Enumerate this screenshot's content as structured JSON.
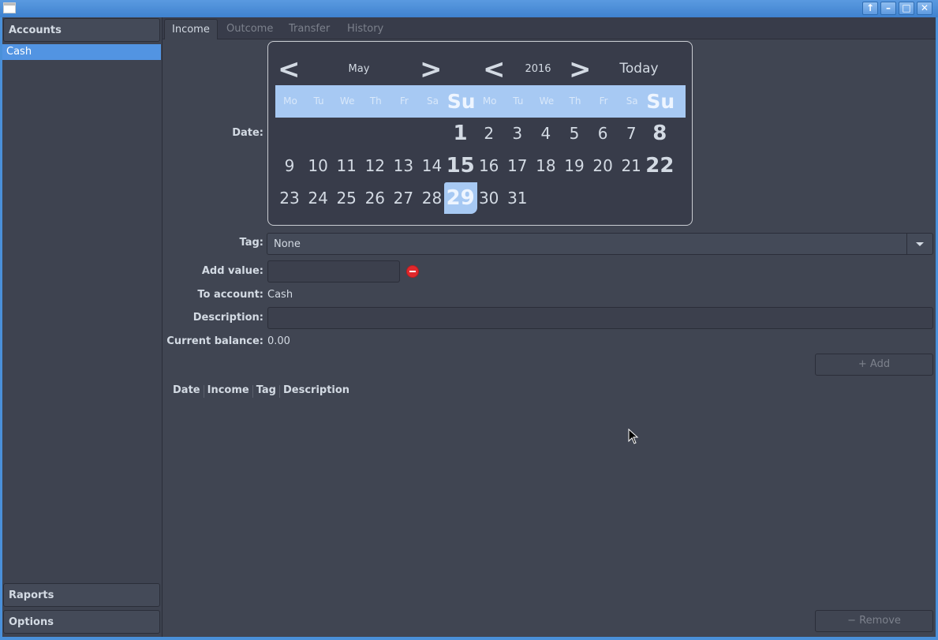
{
  "window": {
    "title_buttons": [
      "up-arrow",
      "minimize",
      "maximize",
      "close"
    ]
  },
  "sidebar": {
    "accounts_header": "Accounts",
    "accounts": [
      {
        "label": "Cash",
        "selected": true
      }
    ],
    "raports_header": "Raports",
    "options_header": "Options"
  },
  "tabs": [
    {
      "label": "Income",
      "active": true
    },
    {
      "label": "Outcome",
      "active": false
    },
    {
      "label": "Transfer",
      "active": false
    },
    {
      "label": "History",
      "active": false
    }
  ],
  "form": {
    "date_label": "Date:",
    "tag_label": "Tag:",
    "tag_value": "None",
    "add_value_label": "Add value:",
    "add_value": "",
    "to_account_label": "To account:",
    "to_account_value": "Cash",
    "description_label": "Description:",
    "description_value": "",
    "balance_label": "Current balance:",
    "balance_value": "0.00",
    "add_button": "+ Add",
    "remove_button": "− Remove"
  },
  "table": {
    "columns": [
      "Date",
      "Income",
      "Tag",
      "Description"
    ]
  },
  "calendar": {
    "prev_symbol": "<",
    "next_symbol": ">",
    "month": "May",
    "year": "2016",
    "today_label": "Today",
    "weekdays": [
      "Mo",
      "Tu",
      "We",
      "Th",
      "Fr",
      "Sa",
      "Su",
      "Mo",
      "Tu",
      "We",
      "Th",
      "Fr",
      "Sa",
      "Su"
    ],
    "selected_day": "29",
    "rows": [
      [
        "",
        "",
        "",
        "",
        "",
        "",
        "1",
        "2",
        "3",
        "4",
        "5",
        "6",
        "7",
        "8"
      ],
      [
        "9",
        "10",
        "11",
        "12",
        "13",
        "14",
        "15",
        "16",
        "17",
        "18",
        "19",
        "20",
        "21",
        "22"
      ],
      [
        "23",
        "24",
        "25",
        "26",
        "27",
        "28",
        "29",
        "30",
        "31",
        "",
        "",
        "",
        "",
        ""
      ]
    ]
  },
  "colors": {
    "selection": "#5294e2",
    "calendar_highlight": "#a7c9f3",
    "background": "#404552"
  }
}
